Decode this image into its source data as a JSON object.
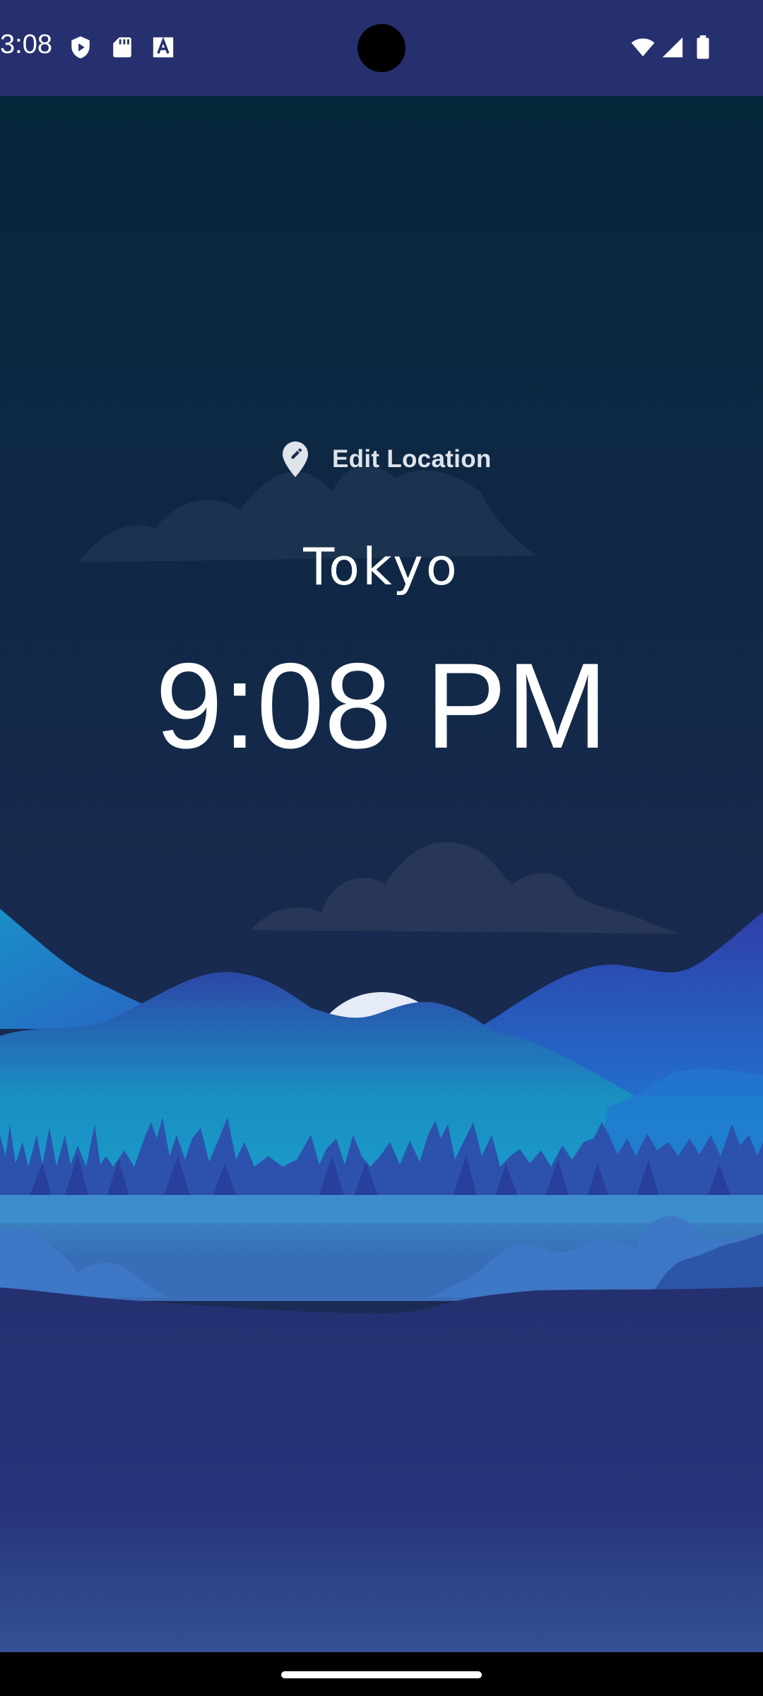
{
  "status_bar": {
    "time": "3:08",
    "left_icons": [
      "play-protect-icon",
      "sd-card-icon",
      "font-a-icon"
    ],
    "right_icons": [
      "wifi-icon",
      "signal-icon",
      "battery-icon"
    ],
    "background": "#26306e"
  },
  "main": {
    "edit_location_label": "Edit Location",
    "city": "Tokyo",
    "time": "9:08 PM"
  },
  "scene": {
    "sky_top": "#06263a",
    "sky_bottom": "#1e2b5a",
    "moon": "#e6ecf7",
    "ground": "#26326e"
  }
}
